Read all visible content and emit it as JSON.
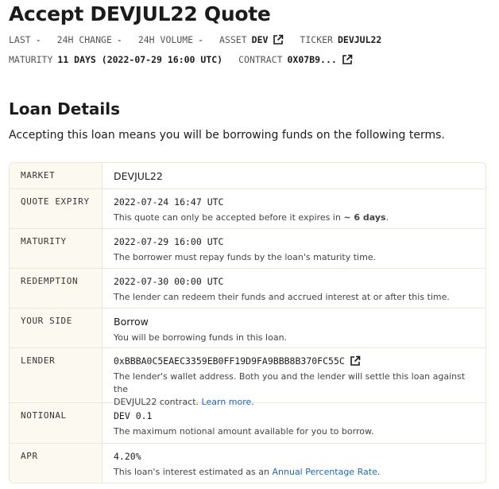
{
  "header": {
    "title": "Accept DEVJUL22 Quote",
    "last_label": "LAST",
    "last_value": "-",
    "change_label": "24H CHANGE",
    "change_value": "-",
    "volume_label": "24H VOLUME",
    "volume_value": "-",
    "asset_label": "ASSET",
    "asset_value": "DEV",
    "ticker_label": "TICKER",
    "ticker_value": "DEVJUL22",
    "maturity_label": "MATURITY",
    "maturity_value": "11 DAYS (2022-07-29 16:00 UTC)",
    "contract_label": "CONTRACT",
    "contract_value": "0X07B9..."
  },
  "section": {
    "title": "Loan Details",
    "description": "Accepting this loan means you will be borrowing funds on the following terms."
  },
  "details": [
    {
      "key": "MARKET",
      "value": "DEVJUL22",
      "mono": false
    },
    {
      "key": "QUOTE EXPIRY",
      "value": "2022-07-24 16:47 UTC",
      "mono": true,
      "note_prefix": "This quote can only be accepted before it expires in",
      "note_bold": "~ 6 days",
      "note_suffix": "."
    },
    {
      "key": "MATURITY",
      "value": "2022-07-29 16:00 UTC",
      "mono": true,
      "note": "The borrower must repay funds by the loan's maturity time."
    },
    {
      "key": "REDEMPTION",
      "value": "2022-07-30 00:00 UTC",
      "mono": true,
      "note": "The lender can redeem their funds and accrued interest at or after this time."
    },
    {
      "key": "YOUR SIDE",
      "value": "Borrow",
      "mono": false,
      "note": "You will be borrowing funds in this loan."
    },
    {
      "key": "LENDER",
      "value": "0xBBBA0C5EAEC3359EB0FF19D9FA9BBB8B370FC55C",
      "mono": true,
      "note_line1": "The lender's wallet address. Both you and the lender will settle this loan against the",
      "note_line2": "DEVJUL22 contract.",
      "link": "Learn more",
      "link_suffix": "."
    },
    {
      "key": "NOTIONAL",
      "value": "DEV 0.1",
      "mono": true,
      "note": "The maximum notional amount available for you to borrow."
    },
    {
      "key": "APR",
      "value": "4.20%",
      "mono": true,
      "note_prefix": "This loan's interest estimated as an",
      "link": "Annual Percentage Rate",
      "link_suffix": "."
    }
  ],
  "colors": {
    "link": "#1d68b8",
    "key_bg": "#fcf9f0",
    "border": "#ece6d7"
  },
  "icons": {
    "external": "external-link-icon"
  }
}
